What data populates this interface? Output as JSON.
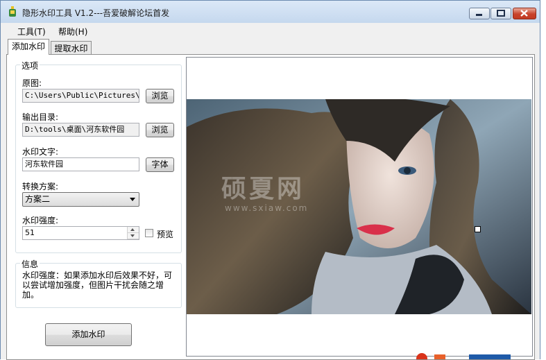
{
  "window": {
    "title": "隐形水印工具 V1.2---吾爱破解论坛首发"
  },
  "menu": {
    "items": [
      "工具(T)",
      "帮助(H)"
    ]
  },
  "tabs": [
    {
      "label": "添加水印",
      "active": true
    },
    {
      "label": "提取水印",
      "active": false
    }
  ],
  "options": {
    "legend": "选项",
    "source_label": "原图:",
    "source_value": "C:\\Users\\Public\\Pictures\\Sa",
    "browse1": "浏览",
    "output_label": "输出目录:",
    "output_value": "D:\\tools\\桌面\\河东软件园",
    "browse2": "浏览",
    "text_label": "水印文字:",
    "text_value": "河东软件园",
    "font_button": "字体",
    "scheme_label": "转换方案:",
    "scheme_value": "方案二",
    "strength_label": "水印强度:",
    "strength_value": "51",
    "preview_label": "预览"
  },
  "info": {
    "legend": "信息",
    "text": "水印强度：如果添加水印后效果不好，可以尝试增加强度，但图片干扰会随之增加。"
  },
  "actions": {
    "add_watermark": "添加水印"
  },
  "preview": {
    "watermark_main": "硕夏网",
    "watermark_sub": "www.sxiaw.com"
  },
  "colors": {
    "titlebar": "#c5d8ee",
    "close_button": "#c8432c",
    "lips": "#d9304a"
  }
}
